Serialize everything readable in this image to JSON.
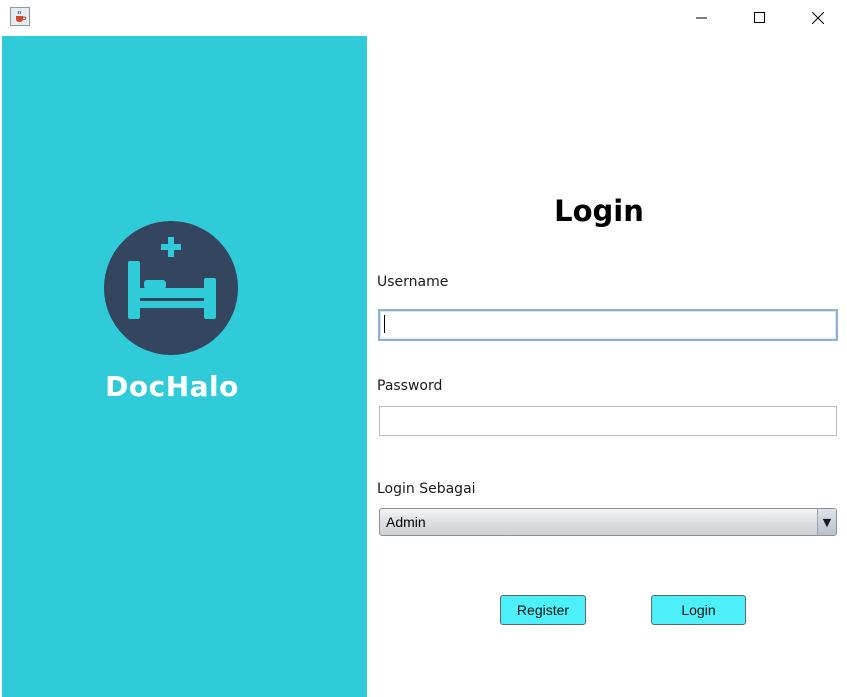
{
  "window": {
    "icons": {
      "app": "java-cup-icon",
      "minimize": "minimize-icon",
      "maximize": "maximize-icon",
      "close": "close-icon"
    }
  },
  "brand": {
    "name": "DocHalo",
    "logo_icon": "hospital-bed-icon",
    "panel_color": "#30cbd9",
    "logo_bg_color": "#344560"
  },
  "form": {
    "title": "Login",
    "username": {
      "label": "Username",
      "value": ""
    },
    "password": {
      "label": "Password",
      "value": ""
    },
    "role": {
      "label": "Login Sebagai",
      "selected": "Admin"
    },
    "buttons": {
      "register": "Register",
      "login": "Login"
    },
    "button_color": "#4df0f8"
  }
}
